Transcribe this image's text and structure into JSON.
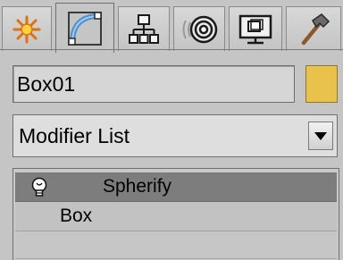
{
  "command_panel": {
    "tabs": [
      {
        "name": "Create",
        "icon": "create-burst-icon"
      },
      {
        "name": "Modify",
        "icon": "modify-arc-icon",
        "active": true
      },
      {
        "name": "Hierarchy",
        "icon": "hierarchy-icon"
      },
      {
        "name": "Motion",
        "icon": "motion-rings-icon"
      },
      {
        "name": "Display",
        "icon": "display-monitor-icon"
      },
      {
        "name": "Utilities",
        "icon": "utilities-hammer-icon"
      }
    ],
    "object_name": "Box01",
    "object_color": "#e8c24a",
    "modifier_list": {
      "selected": "Modifier List"
    },
    "stack": {
      "items": [
        {
          "label": "Spherify",
          "selected": true,
          "icon": "lightbulb-icon"
        },
        {
          "label": "Box",
          "selected": false
        }
      ]
    }
  }
}
